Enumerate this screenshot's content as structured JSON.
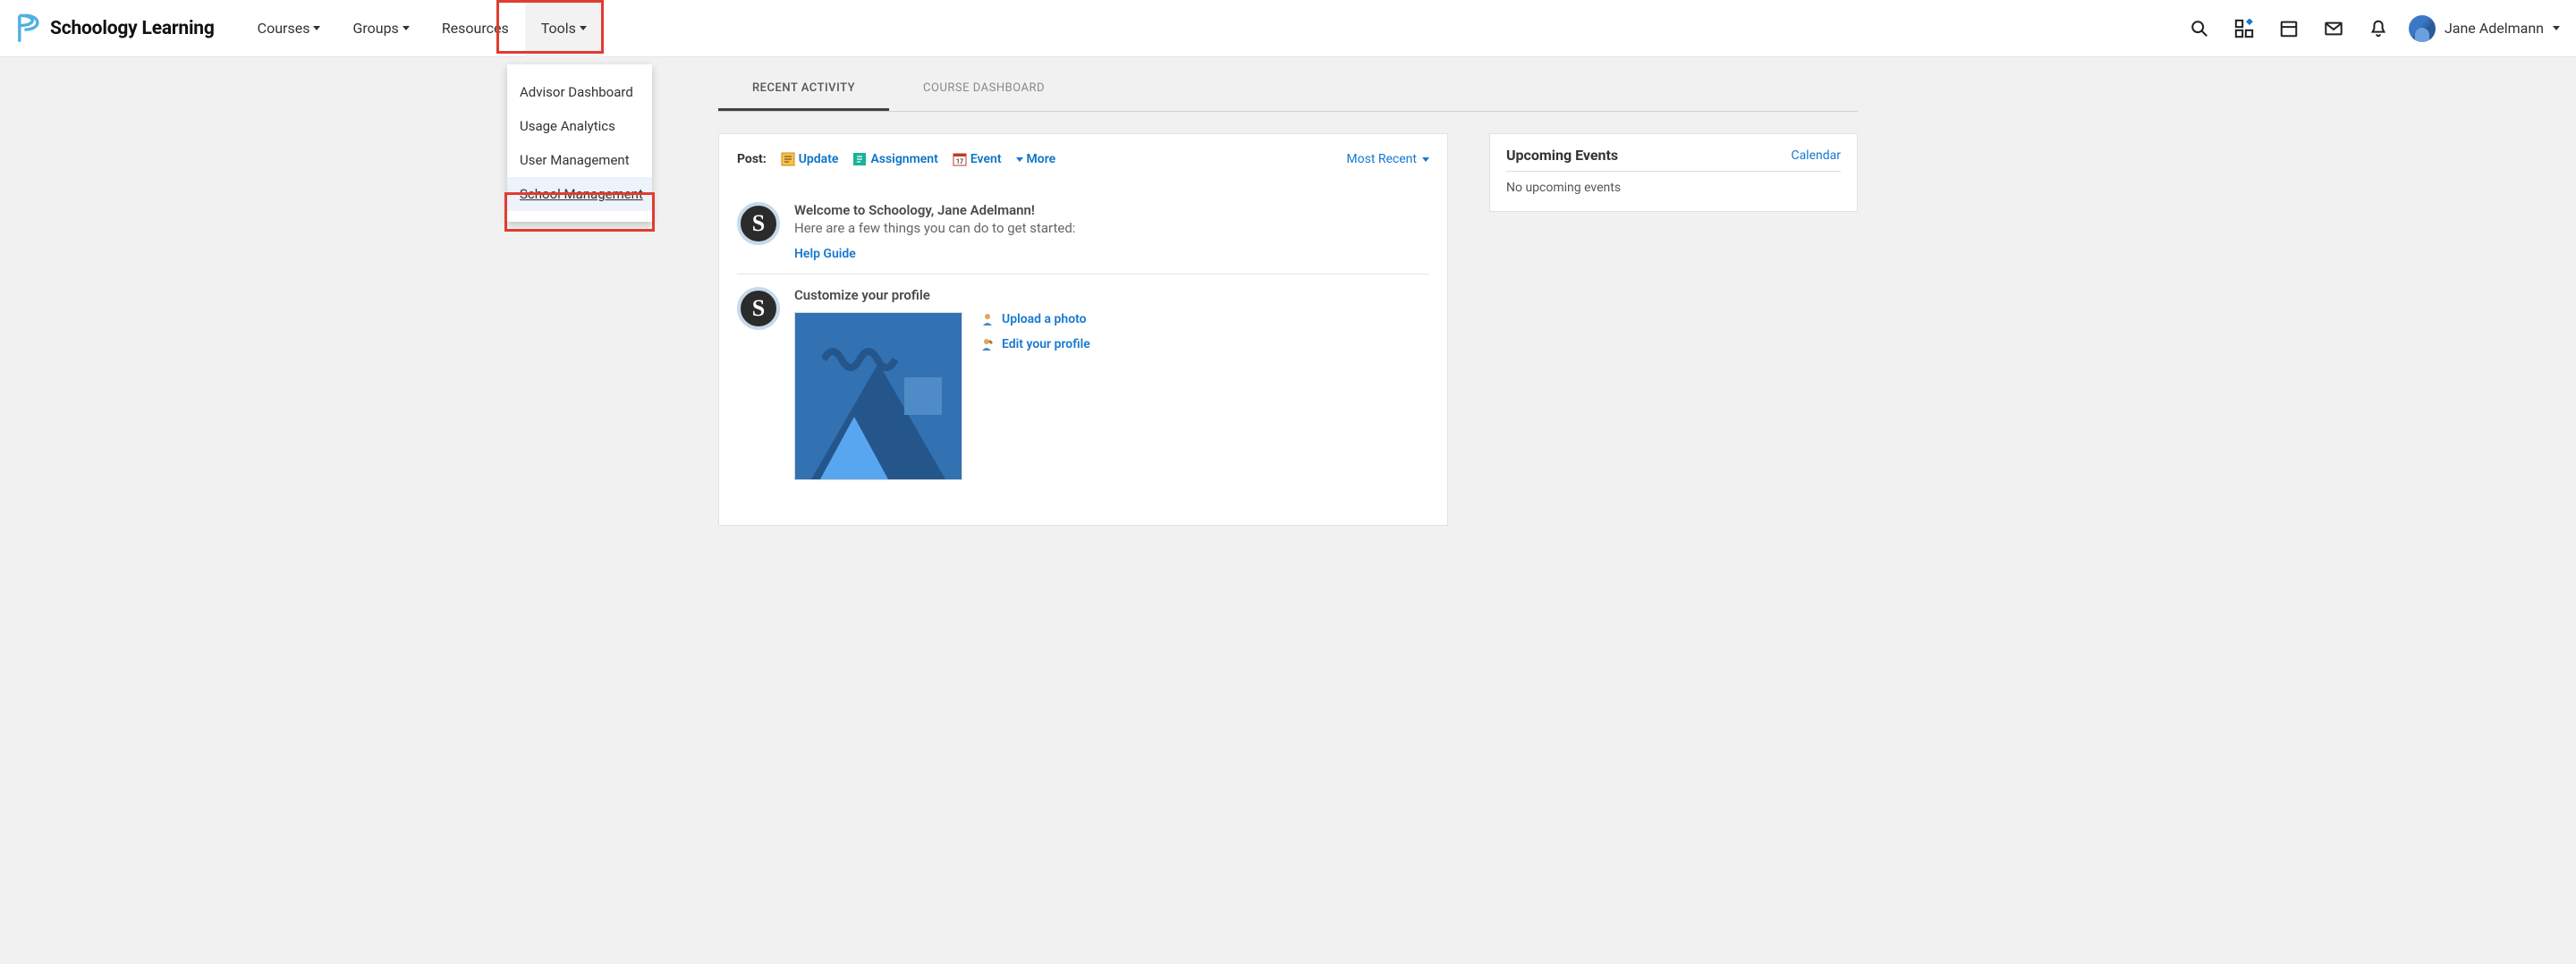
{
  "brand": {
    "name": "Schoology Learning"
  },
  "nav": {
    "courses": "Courses",
    "groups": "Groups",
    "resources": "Resources",
    "tools": "Tools"
  },
  "tools_menu": {
    "items": [
      "Advisor Dashboard",
      "Usage Analytics",
      "User Management",
      "School Management"
    ]
  },
  "user": {
    "name": "Jane Adelmann"
  },
  "tabs": {
    "recent": "RECENT ACTIVITY",
    "dashboard": "COURSE DASHBOARD"
  },
  "post_bar": {
    "label": "Post:",
    "update": "Update",
    "assignment": "Assignment",
    "event": "Event",
    "more": "More",
    "sort": "Most Recent"
  },
  "feed": {
    "welcome_title": "Welcome to Schoology, Jane Adelmann!",
    "welcome_sub": "Here are a few things you can do to get started:",
    "help_guide": "Help Guide",
    "customize_title": "Customize your profile",
    "upload_photo": "Upload a photo",
    "edit_profile": "Edit your profile"
  },
  "sidebar": {
    "upcoming_title": "Upcoming Events",
    "calendar_link": "Calendar",
    "empty_msg": "No upcoming events"
  }
}
